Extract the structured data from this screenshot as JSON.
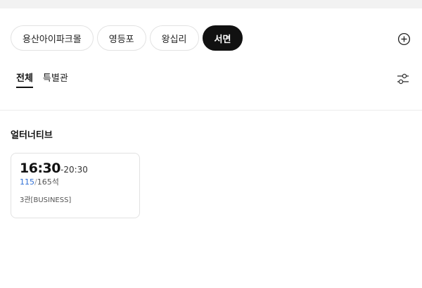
{
  "theaters": [
    {
      "label": "용산아이파크몰",
      "active": false
    },
    {
      "label": "영등포",
      "active": false
    },
    {
      "label": "왕십리",
      "active": false
    },
    {
      "label": "서면",
      "active": true
    }
  ],
  "tabs": [
    {
      "label": "전체",
      "active": true
    },
    {
      "label": "특별관",
      "active": false
    }
  ],
  "icons": {
    "add": "plus-circle-icon",
    "filter": "sliders-icon"
  },
  "section": {
    "title": "얼터너티브",
    "showtimes": [
      {
        "start": "16:30",
        "end": "-20:30",
        "seats_available": "115",
        "seats_separator": "/",
        "seats_total": "165석",
        "screen": "3관[BUSINESS]"
      }
    ]
  },
  "colors": {
    "active_chip": "#111111",
    "seats_available": "#2f6fd6"
  }
}
